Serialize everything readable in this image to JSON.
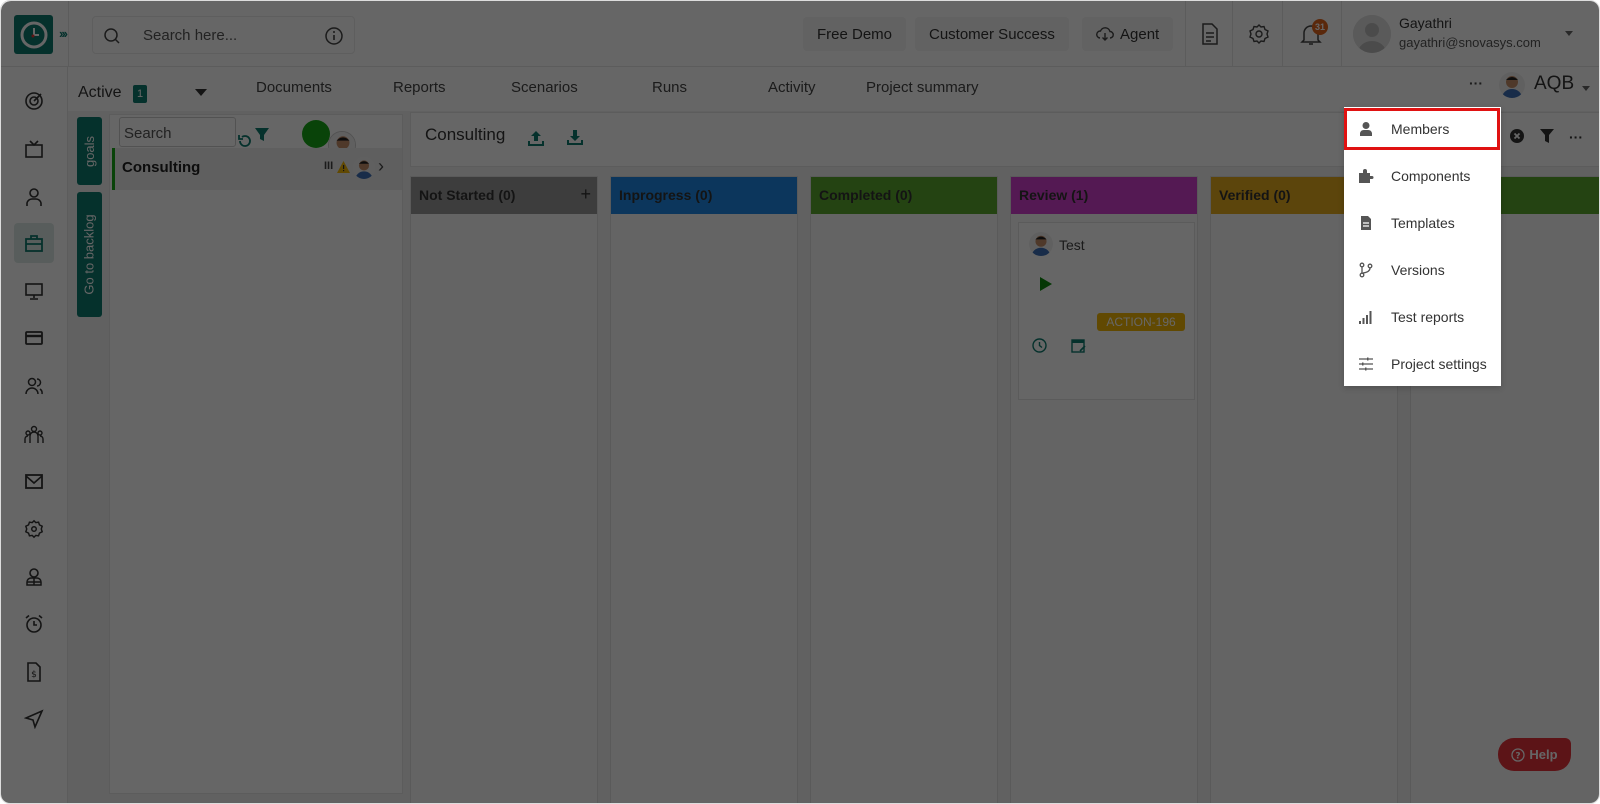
{
  "topbar": {
    "search_placeholder": "Search here...",
    "free_demo": "Free Demo",
    "customer_success": "Customer Success",
    "agent": "Agent",
    "notification_count": "31",
    "user_name": "Gayathri",
    "user_email": "gayathri@snovasys.com"
  },
  "subnav": {
    "active_label": "Active",
    "active_count": "1",
    "tabs": [
      "Documents",
      "Reports",
      "Scenarios",
      "Runs",
      "Activity",
      "Project summary"
    ],
    "project_code": "AQB"
  },
  "side_tabs": {
    "goals": "goals",
    "backlog": "Go to backlog"
  },
  "goals_panel": {
    "search_placeholder": "Search",
    "goal_name": "Consulting"
  },
  "board": {
    "title": "Consulting",
    "columns": [
      {
        "label": "Not Started (0)",
        "color": "#999999"
      },
      {
        "label": "Inprogress (0)",
        "color": "#1e88e5"
      },
      {
        "label": "Completed (0)",
        "color": "#5aa82e"
      },
      {
        "label": "Review (1)",
        "color": "#d23fcf"
      },
      {
        "label": "Verified (0)",
        "color": "#e6ac1f"
      },
      {
        "label": "",
        "color": "#5aa82e"
      }
    ],
    "card": {
      "title": "Test",
      "tag": "ACTION-196"
    }
  },
  "menu": {
    "items": [
      "Members",
      "Components",
      "Templates",
      "Versions",
      "Test reports",
      "Project settings"
    ]
  },
  "help": {
    "label": "Help"
  }
}
